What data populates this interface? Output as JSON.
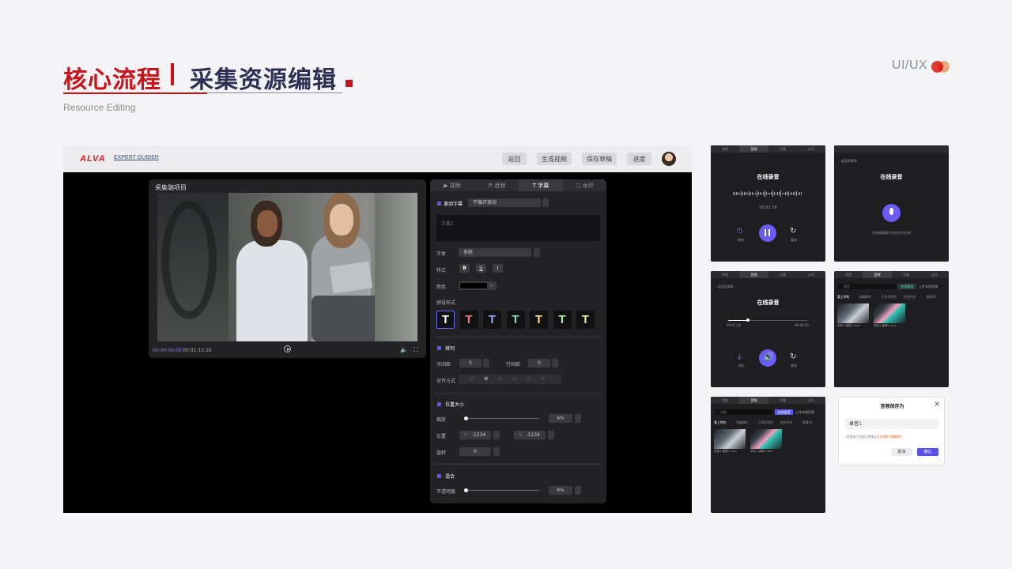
{
  "header": {
    "title_part1": "核心流程",
    "title_part2": "采集资源编辑",
    "subtitle": "Resource Editing",
    "tag": "UI/UX"
  },
  "editor": {
    "brand": "ALVA",
    "brand_sub": "EXPERT GUIDER",
    "toolbar": [
      "返回",
      "生成视频",
      "保存草稿",
      "进度"
    ],
    "video": {
      "title": "采集端项目",
      "time_current": "00:00:00:00",
      "time_total": "00:01:13:16"
    },
    "tabs": [
      "视频",
      "音频",
      "字幕",
      "水印"
    ],
    "active_tab": "字幕",
    "subtitle_panel": {
      "scroll_label": "滚动字幕",
      "scroll_mode": "不循环滚动",
      "text_placeholder": "字幕1",
      "font_label": "字体",
      "font_value": "系统",
      "style_label": "样式",
      "style_buttons": [
        "B",
        "U",
        "I"
      ],
      "color_label": "颜色",
      "preset_label": "预设样式",
      "preset_glyph": "T",
      "preset_colors": [
        "#ffffff",
        "#f08080",
        "#8fa8ff",
        "#7fe0c0",
        "#f0e080",
        "#a8f0a0",
        "#d8f0a0"
      ],
      "arrange_label": "排列",
      "char_spacing_label": "字间距",
      "char_spacing_value": "0",
      "line_spacing_label": "行间距",
      "line_spacing_value": "0",
      "align_label": "对齐方式",
      "position_section": "位置大小",
      "scale_label": "缩放",
      "scale_value": "6%",
      "position_label": "位置",
      "x_label": "X",
      "x_value": "-1234",
      "y_label": "Y",
      "y_value": "-1234",
      "rotate_label": "旋转",
      "rotate_value": "0",
      "blend_section": "混合",
      "opacity_label": "不透明度",
      "opacity_value": "6%"
    }
  },
  "phones": {
    "tabs": [
      "视频",
      "音频",
      "字幕",
      "水印"
    ],
    "back_label": "返回资源库",
    "record_title": "在线录音",
    "record_time": "00:01:78",
    "end_label": "结束",
    "redo_label": "重录",
    "mic_hint": "在线录制最大时长为10分钟",
    "play_start": "00:01:28",
    "play_end": "00:05:00",
    "save_label": "保存",
    "search_placeholder": "搜索",
    "record_btn": "在线录音",
    "upload_btn": "上传本地资源",
    "categories": [
      "我上传的",
      "我编辑的",
      "分享给我的",
      "机构共享",
      "收藏夹1"
    ],
    "file_names": [
      "录音1-编辑1.mp4",
      "录音1-编辑1.mp4"
    ]
  },
  "dialog": {
    "title": "音频保存为",
    "input_value": "录音1",
    "note_prefix": "*音频加工完成后将保存",
    "note_highlight": "至资源库-我编辑的",
    "cancel": "取消",
    "confirm": "确认"
  }
}
